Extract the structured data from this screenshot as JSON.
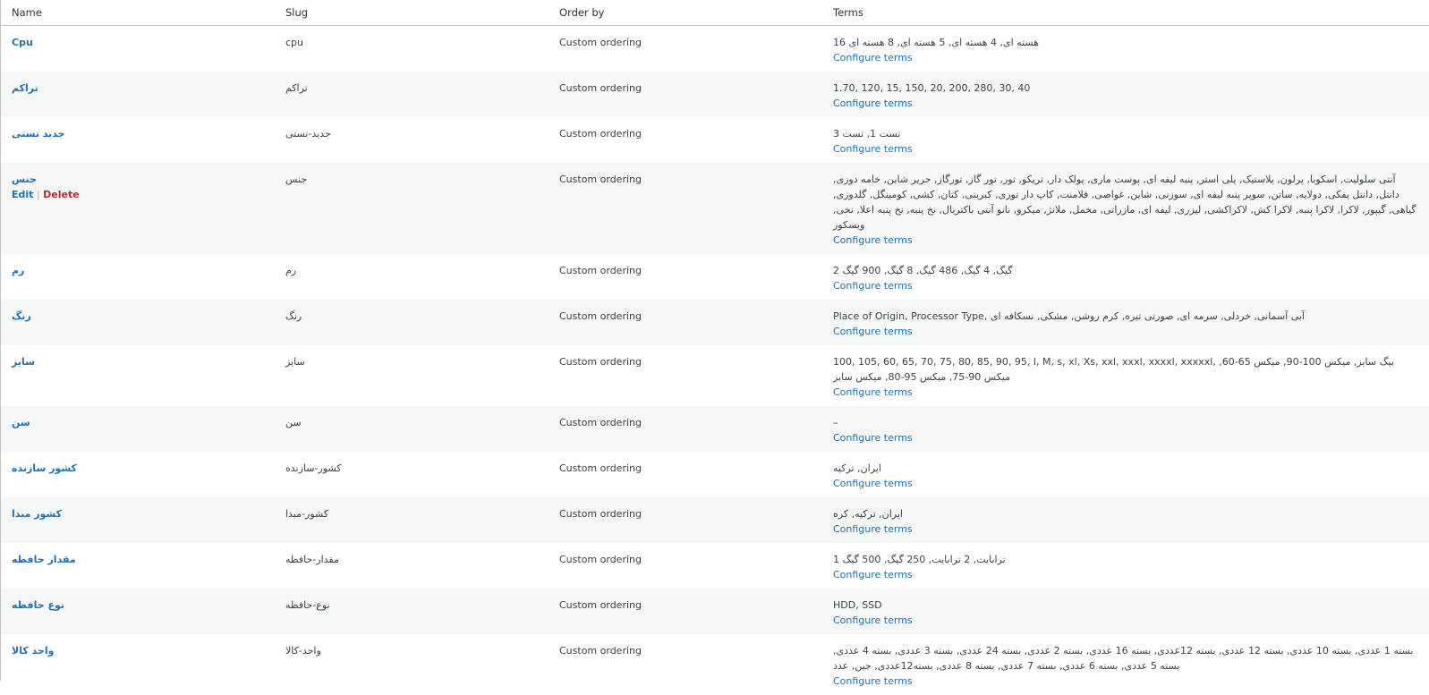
{
  "columns": {
    "name": "Name",
    "slug": "Slug",
    "order_by": "Order by",
    "terms": "Terms"
  },
  "config_label": "Configure terms",
  "actions": {
    "edit": "Edit",
    "delete": "Delete"
  },
  "rows": [
    {
      "name": "Cpu",
      "slug": "cpu",
      "order": "Custom ordering",
      "terms": "هسته ای, 4 هسته ای, 5 هسته ای, 8 هسته ای 16"
    },
    {
      "name": "تراکم",
      "slug": "تراکم",
      "order": "Custom ordering",
      "terms": "1.70, 120, 15, 150, 20, 200, 280, 30, 40"
    },
    {
      "name": "جدید تستی",
      "slug": "جدید-تستی",
      "order": "Custom ordering",
      "terms": "تست 1, تست 3"
    },
    {
      "name": "جنس",
      "slug": "جنس",
      "order": "Custom ordering",
      "terms": "آنتی سلولیت, اسکوبا, پرلون, پلاستیک, پلی استر, پنبه لیفه ای, پوست ماری, پولک دار, تریکو, تور, تور گاز, تورگاز, حریر شاین, خامه دوزی, دانتل, دانتل پفکی, دولایه, ساتن, سوپر پنبه لیفه ای, سوزنی, شاین, غواصی, فلامنت, کاپ دار توری, کبریتی, کتان, کشی, کومینگل, گلدوزی, گیاهی, گیپور, لاکرا, لاکرا پنبه, لاکرا کش, لاکراکشی, لیزری, لیفه ای, مازراتی, مخمل, ملانژ, میکرو, نانو آنتی باکتریال, نخ پنبه, نخ پنبه اعلا, نخی, ویسکوز"
    },
    {
      "name": "رم",
      "slug": "رم",
      "order": "Custom ordering",
      "terms": "گیگ, 4 گیگ, 486 گیگ, 8 گیگ, 900 گیگ 2"
    },
    {
      "name": "رنگ",
      "slug": "رنگ",
      "order": "Custom ordering",
      "terms": "Place of Origin, Processor Type, آبی آسمانی, خردلی, سرمه ای, صورتی تیره, کرم روشن, مشکی, نسکافه ای"
    },
    {
      "name": "سایز",
      "slug": "سایز",
      "order": "Custom ordering",
      "terms": "100, 105, 60, 65, 70, 75, 80, 85, 90, 95, l, M, s, xl, Xs, xxl, xxxl, xxxxl, xxxxxl, بیگ سایز, میکس 100-90, میکس 65-60, میکس 90-75, میکس 95-80, میکس سایز"
    },
    {
      "name": "سن",
      "slug": "سن",
      "order": "Custom ordering",
      "terms": "–"
    },
    {
      "name": "کشور سازنده",
      "slug": "کشور-سازنده",
      "order": "Custom ordering",
      "terms": "ایران, ترکیه"
    },
    {
      "name": "کشور مبدا",
      "slug": "کشور-مبدا",
      "order": "Custom ordering",
      "terms": "ایران, ترکیه, کره"
    },
    {
      "name": "مقدار حافظه",
      "slug": "مقدار-حافظه",
      "order": "Custom ordering",
      "terms": "ترابایت, 2 ترابایت, 250 گیگ, 500 گیگ 1"
    },
    {
      "name": "نوع حافظه",
      "slug": "نوع-حافظه",
      "order": "Custom ordering",
      "terms": "HDD, SSD"
    },
    {
      "name": "واحد کالا",
      "slug": "واحد-کالا",
      "order": "Custom ordering",
      "terms": "بسته 1 عددی, بسته 10 عددی, بسته 12 عددی, بسته 12عددی, بسته 16 عددی, بسته 2 عددی, بسته 24 عددی, بسته 3 عددی, بسته 4 عددی, بسته 5 عددی, بسته 6 عددی, بسته 7 عددی, بسته 8 عددی, بسته12عددی, جین, عدد"
    }
  ]
}
